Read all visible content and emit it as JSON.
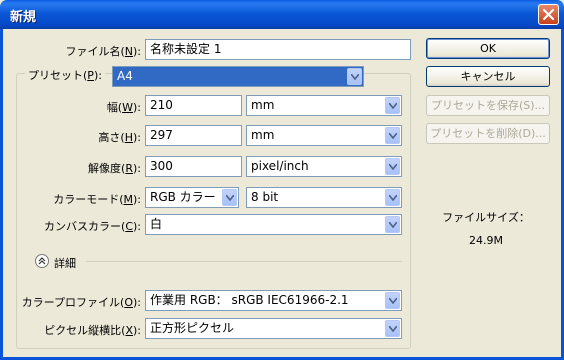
{
  "window": {
    "title": "新規"
  },
  "name": {
    "label": "ファイル名(",
    "key": "N",
    "end": "):",
    "value": "名称未設定 1"
  },
  "preset": {
    "label": "プリセット(",
    "key": "P",
    "end": "):",
    "value": "A4"
  },
  "width": {
    "label": "幅(",
    "key": "W",
    "end": "):",
    "value": "210",
    "unit": "mm"
  },
  "height": {
    "label": "高さ(",
    "key": "H",
    "end": "):",
    "value": "297",
    "unit": "mm"
  },
  "resolution": {
    "label": "解像度(",
    "key": "R",
    "end": "):",
    "value": "300",
    "unit": "pixel/inch"
  },
  "color_mode": {
    "label": "カラーモード(",
    "key": "M",
    "end": "):",
    "mode": "RGB カラー",
    "depth": "8 bit"
  },
  "background": {
    "label": "カンバスカラー(",
    "key": "C",
    "end": "):",
    "value": "白"
  },
  "details": {
    "label": "詳細"
  },
  "profile": {
    "label": "カラープロファイル(",
    "key": "O",
    "end": "):",
    "value": "作業用 RGB： sRGB IEC61966-2.1"
  },
  "pixel_aspect": {
    "label": "ピクセル縦横比(",
    "key": "X",
    "end": "):",
    "value": "正方形ピクセル"
  },
  "buttons": {
    "ok": "OK",
    "cancel": "キャンセル",
    "save_preset": "プリセットを保存(S)...",
    "delete_preset": "プリセットを削除(D)..."
  },
  "file_size": {
    "label": "ファイルサイズ：",
    "value": "24.9M"
  },
  "icons": {
    "close": "close-icon",
    "dropdown": "chevron-down-icon",
    "details": "chevron-up-icon"
  }
}
